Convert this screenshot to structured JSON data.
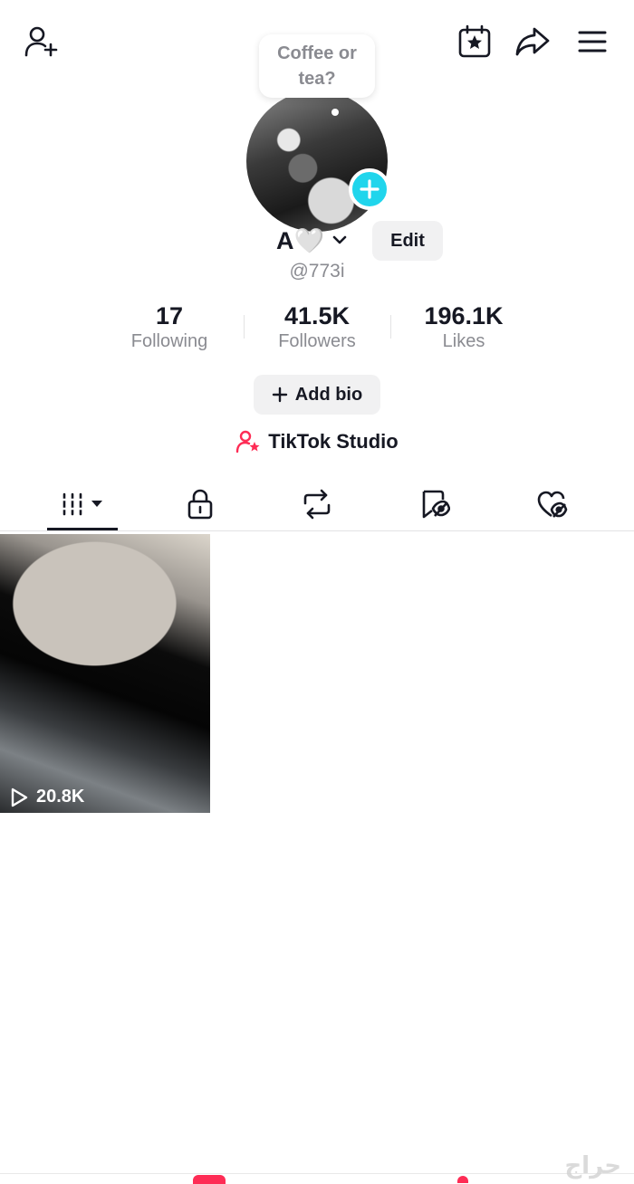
{
  "header": {
    "icons": [
      "add-friend-icon",
      "calendar-star-icon",
      "share-icon",
      "menu-icon"
    ]
  },
  "profile": {
    "bubble_text": "Coffee or tea?",
    "name": "A🤍",
    "edit_label": "Edit",
    "handle": "@773i"
  },
  "stats": [
    {
      "value": "17",
      "label": "Following"
    },
    {
      "value": "41.5K",
      "label": "Followers"
    },
    {
      "value": "196.1K",
      "label": "Likes"
    }
  ],
  "actions": {
    "add_bio": "Add bio",
    "studio": "TikTok Studio"
  },
  "tabs": [
    {
      "icon": "videos-grid-icon",
      "selected": true
    },
    {
      "icon": "lock-icon",
      "selected": false
    },
    {
      "icon": "repost-icon",
      "selected": false
    },
    {
      "icon": "favorites-icon",
      "selected": false
    },
    {
      "icon": "liked-icon",
      "selected": false
    }
  ],
  "videos": [
    {
      "views": "20.8K"
    }
  ],
  "watermark": "حراج",
  "colors": {
    "accent_cyan": "#20d5ec",
    "tiktok_red": "#fe2c55",
    "text_primary": "#161823",
    "text_secondary": "#8a8b91"
  }
}
